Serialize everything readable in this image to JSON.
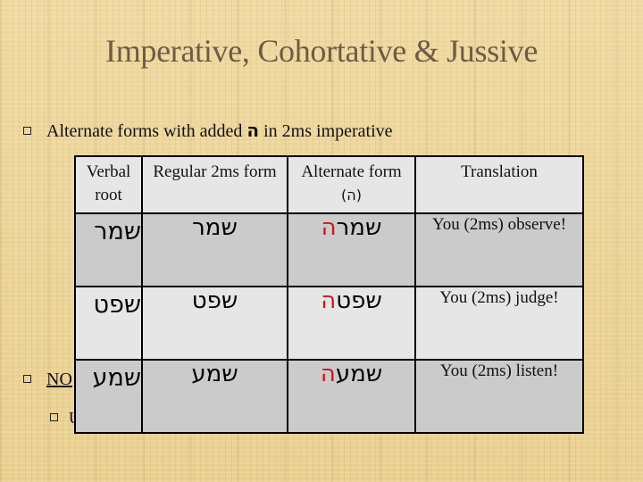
{
  "slide": {
    "title": "Imperative, Cohortative & Jussive",
    "bullets": [
      {
        "text_before": "Alternate forms with added ",
        "hebrew": "ה",
        "text_after": " in 2ms imperative"
      },
      {
        "text": "NO"
      },
      {
        "text": "U"
      }
    ]
  },
  "table": {
    "headers": {
      "root": "Verbal root",
      "regular": "Regular 2ms form",
      "alternate": "Alternate form",
      "alternate_note": "(ה)",
      "translation": "Translation"
    },
    "rows": [
      {
        "root": "שמר",
        "regular": "שמר",
        "alternate_stem": "שמר",
        "alternate_suffix": "ה",
        "translation": "You (2ms) observe!"
      },
      {
        "root": "שפט",
        "regular": "שפט",
        "alternate_stem": "שפט",
        "alternate_suffix": "ה",
        "translation": "You (2ms) judge!"
      },
      {
        "root": "שמע",
        "regular": "שמע",
        "alternate_stem": "שמע",
        "alternate_suffix": "ה",
        "translation": "You (2ms) listen!"
      }
    ]
  },
  "colors": {
    "title": "#6f5a45",
    "suffix_highlight": "#d0141b",
    "row_dark": "#cbcbcb",
    "row_light": "#e6e6e6"
  }
}
